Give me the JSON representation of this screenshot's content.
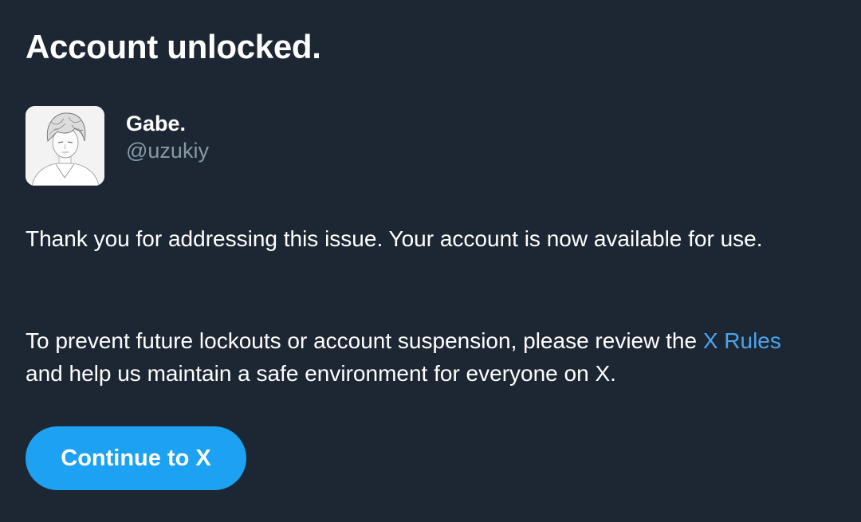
{
  "page": {
    "title": "Account unlocked.",
    "background_color": "#1c2733",
    "accent_color": "#1da1f2",
    "link_color": "#4da3ec"
  },
  "account": {
    "display_name": "Gabe.",
    "handle": "@uzukiy",
    "avatar_icon": "avatar-sketch-portrait-image"
  },
  "message": {
    "paragraph_1": "Thank you for addressing this issue. Your account is now available for use.",
    "paragraph_2_before_link": "To prevent future lockouts or account suspension, please review the ",
    "paragraph_2_link": "X Rules",
    "paragraph_2_after_link": " and help us maintain a safe environment for everyone on X."
  },
  "actions": {
    "continue_label": "Continue to X"
  }
}
